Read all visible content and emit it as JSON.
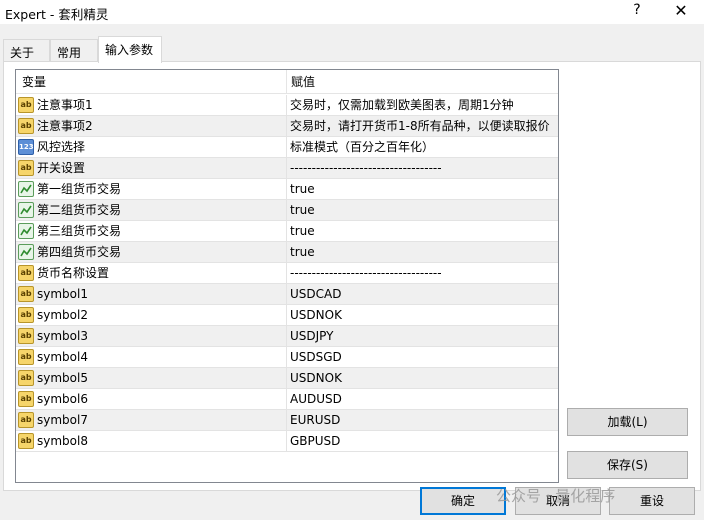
{
  "window": {
    "title": "Expert - 套利精灵",
    "help": "?",
    "close": "✕"
  },
  "tabs": [
    {
      "label": "关于",
      "active": false
    },
    {
      "label": "常用",
      "active": false
    },
    {
      "label": "输入参数",
      "active": true
    }
  ],
  "grid": {
    "columns": [
      "变量",
      "赋值"
    ],
    "rows": [
      {
        "icon": "string-icon",
        "name": "注意事项1",
        "value": "交易时，仅需加载到欧美图表，周期1分钟"
      },
      {
        "icon": "string-icon",
        "name": "注意事项2",
        "value": "交易时，请打开货币1-8所有品种，以便读取报价"
      },
      {
        "icon": "number-icon",
        "name": "风控选择",
        "value": "标准模式（百分之百年化）"
      },
      {
        "icon": "string-icon",
        "name": "开关设置",
        "value": "-----------------------------------"
      },
      {
        "icon": "bool-icon",
        "name": "第一组货币交易",
        "value": "true"
      },
      {
        "icon": "bool-icon",
        "name": "第二组货币交易",
        "value": "true"
      },
      {
        "icon": "bool-icon",
        "name": "第三组货币交易",
        "value": "true"
      },
      {
        "icon": "bool-icon",
        "name": "第四组货币交易",
        "value": "true"
      },
      {
        "icon": "string-icon",
        "name": "货币名称设置",
        "value": "-----------------------------------"
      },
      {
        "icon": "string-icon",
        "name": "symbol1",
        "value": "USDCAD"
      },
      {
        "icon": "string-icon",
        "name": "symbol2",
        "value": "USDNOK"
      },
      {
        "icon": "string-icon",
        "name": "symbol3",
        "value": "USDJPY"
      },
      {
        "icon": "string-icon",
        "name": "symbol4",
        "value": "USDSGD"
      },
      {
        "icon": "string-icon",
        "name": "symbol5",
        "value": "USDNOK"
      },
      {
        "icon": "string-icon",
        "name": "symbol6",
        "value": "AUDUSD"
      },
      {
        "icon": "string-icon",
        "name": "symbol7",
        "value": "EURUSD"
      },
      {
        "icon": "string-icon",
        "name": "symbol8",
        "value": "GBPUSD"
      }
    ]
  },
  "icon_glyphs": {
    "string": "ab",
    "number": "123"
  },
  "buttons": {
    "load": "加载(L)",
    "save": "保存(S)",
    "ok": "确定",
    "cancel": "取消",
    "reset": "重设"
  },
  "watermark": "公众号 · 量化程序",
  "colors": {
    "accent": "#0078d7",
    "alt_row": "#f0f0f0",
    "string_icon": "#f6d56a",
    "number_icon": "#5d8fd6"
  }
}
